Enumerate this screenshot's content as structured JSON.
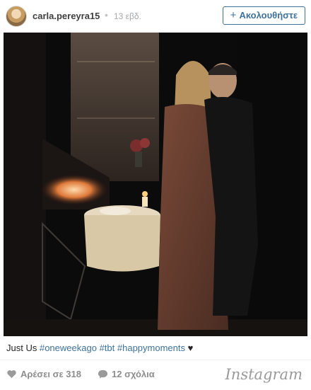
{
  "post": {
    "username": "carla.pereyra15",
    "separator": "•",
    "time_ago": "13 εβδ.",
    "follow_label": "Ακολουθήστε",
    "follow_plus": "+"
  },
  "caption": {
    "text": "Just Us",
    "hashtags": [
      "#oneweekago",
      "#tbt",
      "#happymoments"
    ],
    "emoji": "♥"
  },
  "footer": {
    "likes_label": "Αρέσει σε 318",
    "comments_label": "12 σχόλια",
    "logo": "Instagram"
  },
  "colors": {
    "link": "#3f729b",
    "muted": "#8e8e8e"
  },
  "icons": [
    "heart-icon",
    "comment-icon",
    "plus-icon"
  ]
}
